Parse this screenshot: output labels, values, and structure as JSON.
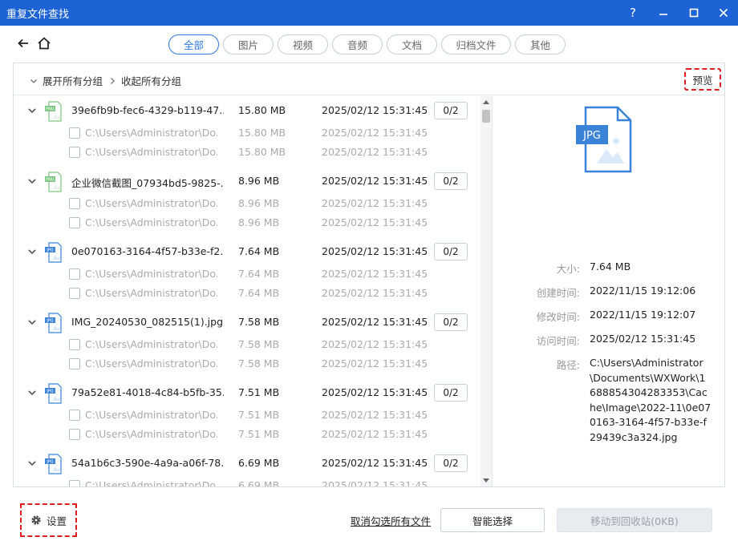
{
  "window": {
    "title": "重复文件查找",
    "help": "?",
    "minimize": "—",
    "maximize": "☐",
    "close": "✕"
  },
  "nav": {
    "back_icon": "arrow-left-icon",
    "home_icon": "home-icon"
  },
  "tabs": [
    {
      "label": "全部",
      "active": true
    },
    {
      "label": "图片",
      "active": false
    },
    {
      "label": "视频",
      "active": false
    },
    {
      "label": "音频",
      "active": false
    },
    {
      "label": "文档",
      "active": false
    },
    {
      "label": "归档文件",
      "active": false
    },
    {
      "label": "其他",
      "active": false
    }
  ],
  "toolbar": {
    "expand_all": "展开所有分组",
    "collapse_all": "收起所有分组",
    "preview": "预览"
  },
  "groups": [
    {
      "name": "39e6fb9b-fec6-4329-b119-47...",
      "type": "PNG",
      "size": "15.80 MB",
      "date": "2025/02/12 15:31:45",
      "count": "0/2",
      "files": [
        {
          "path": "C:\\Users\\Administrator\\Do...",
          "size": "15.80 MB",
          "date": "2025/02/12 15:31:45"
        },
        {
          "path": "C:\\Users\\Administrator\\Do...",
          "size": "15.80 MB",
          "date": "2025/02/12 15:31:45"
        }
      ]
    },
    {
      "name": "企业微信截图_07934bd5-9825-...",
      "type": "PNG",
      "size": "8.96 MB",
      "date": "2025/02/12 15:31:45",
      "count": "0/2",
      "files": [
        {
          "path": "C:\\Users\\Administrator\\Do...",
          "size": "8.96 MB",
          "date": "2025/02/12 15:31:45"
        },
        {
          "path": "C:\\Users\\Administrator\\Do...",
          "size": "8.96 MB",
          "date": "2025/02/12 15:31:45"
        }
      ]
    },
    {
      "name": "0e070163-3164-4f57-b33e-f2...",
      "type": "JPG",
      "size": "7.64 MB",
      "date": "2025/02/12 15:31:45",
      "count": "0/2",
      "files": [
        {
          "path": "C:\\Users\\Administrator\\Do...",
          "size": "7.64 MB",
          "date": "2025/02/12 15:31:45"
        },
        {
          "path": "C:\\Users\\Administrator\\Do...",
          "size": "7.64 MB",
          "date": "2025/02/12 15:31:45"
        }
      ]
    },
    {
      "name": "IMG_20240530_082515(1).jpg",
      "type": "JPG",
      "size": "7.58 MB",
      "date": "2025/02/12 15:31:45",
      "count": "0/2",
      "files": [
        {
          "path": "C:\\Users\\Administrator\\Do...",
          "size": "7.58 MB",
          "date": "2025/02/12 15:31:45"
        },
        {
          "path": "C:\\Users\\Administrator\\Do...",
          "size": "7.58 MB",
          "date": "2025/02/12 15:31:45"
        }
      ]
    },
    {
      "name": "79a52e81-4018-4c84-b5fb-35...",
      "type": "JPG",
      "size": "7.51 MB",
      "date": "2025/02/12 15:31:45",
      "count": "0/2",
      "files": [
        {
          "path": "C:\\Users\\Administrator\\Do...",
          "size": "7.51 MB",
          "date": "2025/02/12 15:31:45"
        },
        {
          "path": "C:\\Users\\Administrator\\Do...",
          "size": "7.51 MB",
          "date": "2025/02/12 15:31:45"
        }
      ]
    },
    {
      "name": "54a1b6c3-590e-4a9a-a06f-78...",
      "type": "JPG",
      "size": "6.69 MB",
      "date": "2025/02/12 15:31:45",
      "count": "0/2",
      "files": [
        {
          "path": "C:\\Users\\Administrator\\Do...",
          "size": "6.69 MB",
          "date": "2025/02/12 15:31:45"
        }
      ]
    }
  ],
  "preview": {
    "icon_label": "JPG",
    "size_label": "大小:",
    "size": "7.64 MB",
    "created_label": "创建时间:",
    "created": "2022/11/15 19:12:06",
    "modified_label": "修改时间:",
    "modified": "2022/11/15 19:12:07",
    "accessed_label": "访问时间:",
    "accessed": "2025/02/12 15:31:45",
    "path_label": "路径:",
    "path": "C:\\Users\\Administrator\\Documents\\WXWork\\1688854304283353\\Cache\\Image\\2022-11\\0e070163-3164-4f57-b33e-f29439c3a324.jpg"
  },
  "footer": {
    "settings": "设置",
    "deselect_all": "取消勾选所有文件",
    "smart_select": "智能选择",
    "move_recycle": "移动到回收站(0KB)"
  },
  "colors": {
    "titlebar": "#1e63d6",
    "accent": "#2f76e0",
    "highlight": "#e02020",
    "png_icon": "#7cc57e",
    "jpg_icon": "#3b82d9"
  }
}
